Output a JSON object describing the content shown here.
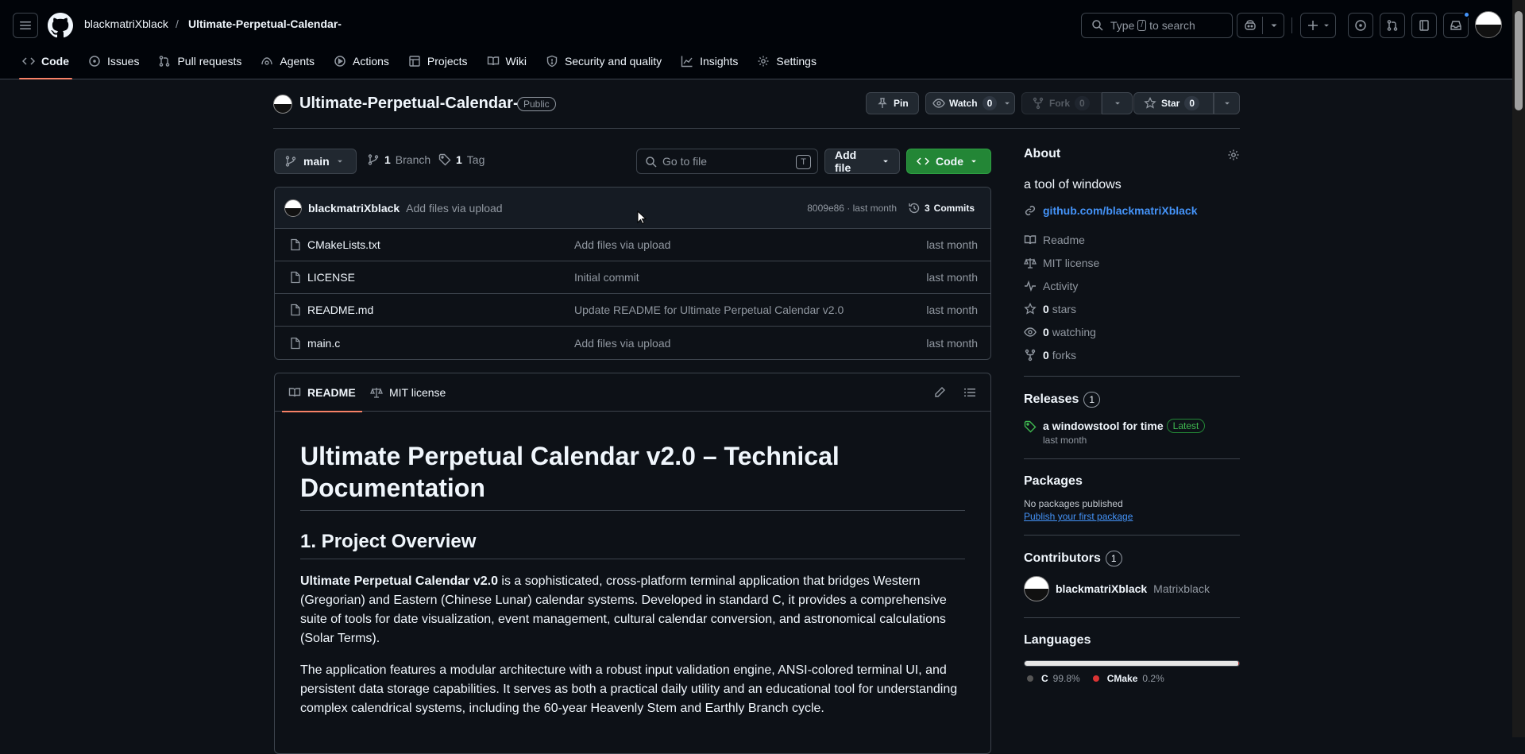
{
  "header": {
    "owner": "blackmatriXblack",
    "separator": "/",
    "repo": "Ultimate-Perpetual-Calendar-",
    "search_prefix": "Type",
    "search_slash": "/",
    "search_suffix": "to search"
  },
  "nav": {
    "tabs": [
      {
        "label": "Code",
        "icon": "code-icon"
      },
      {
        "label": "Issues",
        "icon": "issue-icon"
      },
      {
        "label": "Pull requests",
        "icon": "pull-request-icon"
      },
      {
        "label": "Agents",
        "icon": "agent-icon"
      },
      {
        "label": "Actions",
        "icon": "play-icon"
      },
      {
        "label": "Projects",
        "icon": "table-icon"
      },
      {
        "label": "Wiki",
        "icon": "book-icon"
      },
      {
        "label": "Security and quality",
        "icon": "shield-icon"
      },
      {
        "label": "Insights",
        "icon": "graph-icon"
      },
      {
        "label": "Settings",
        "icon": "gear-icon"
      }
    ]
  },
  "repo_header": {
    "name": "Ultimate-Perpetual-Calendar-",
    "visibility": "Public",
    "pin_label": "Pin",
    "watch_label": "Watch",
    "watch_count": "0",
    "fork_label": "Fork",
    "fork_count": "0",
    "star_label": "Star",
    "star_count": "0"
  },
  "toolbar": {
    "branch": "main",
    "branch_count": "1",
    "branch_label": "Branch",
    "tag_count": "1",
    "tag_label": "Tag",
    "goto_placeholder": "Go to file",
    "goto_key": "T",
    "add_file": "Add file",
    "code": "Code"
  },
  "commit": {
    "author": "blackmatriXblack",
    "message": "Add files via upload",
    "hash_time": "8009e86 · last month",
    "commits_count": "3",
    "commits_label": "Commits"
  },
  "files": [
    {
      "name": "CMakeLists.txt",
      "message": "Add files via upload",
      "age": "last month"
    },
    {
      "name": "LICENSE",
      "message": "Initial commit",
      "age": "last month"
    },
    {
      "name": "README.md",
      "message": "Update README for Ultimate Perpetual Calendar v2.0",
      "age": "last month"
    },
    {
      "name": "main.c",
      "message": "Add files via upload",
      "age": "last month"
    }
  ],
  "readme": {
    "tab_readme": "README",
    "tab_license": "MIT license",
    "h1": "Ultimate Perpetual Calendar v2.0 – Technical Documentation",
    "h2": "1. Project Overview",
    "p1_bold": "Ultimate Perpetual Calendar v2.0",
    "p1_rest": " is a sophisticated, cross-platform terminal application that bridges Western (Gregorian) and Eastern (Chinese Lunar) calendar systems. Developed in standard C, it provides a comprehensive suite of tools for date visualization, event management, cultural calendar conversion, and astronomical calculations (Solar Terms).",
    "p2": "The application features a modular architecture with a robust input validation engine, ANSI-colored terminal UI, and persistent data storage capabilities. It serves as both a practical daily utility and an educational tool for understanding complex calendrical systems, including the 60-year Heavenly Stem and Earthly Branch cycle."
  },
  "about": {
    "title": "About",
    "description": "a tool of windows",
    "link": "github.com/blackmatriXblack",
    "readme": "Readme",
    "license": "MIT license",
    "activity": "Activity",
    "stars_count": "0",
    "stars_label": "stars",
    "watching_count": "0",
    "watching_label": "watching",
    "forks_count": "0",
    "forks_label": "forks"
  },
  "releases": {
    "title": "Releases",
    "count": "1",
    "name": "a windowstool for time",
    "badge": "Latest",
    "date": "last month"
  },
  "packages": {
    "title": "Packages",
    "none": "No packages published",
    "publish": "Publish your first package"
  },
  "contributors": {
    "title": "Contributors",
    "count": "1",
    "login": "blackmatriXblack",
    "name": "Matrixblack"
  },
  "languages": {
    "title": "Languages",
    "items": [
      {
        "name": "C",
        "percent": "99.8%",
        "color": "#555555",
        "share": 99.8
      },
      {
        "name": "CMake",
        "percent": "0.2%",
        "color": "#da3434",
        "share": 0.2
      }
    ]
  },
  "colors": {
    "accent": "#f78166",
    "link": "#4493f8",
    "success": "#238636"
  }
}
